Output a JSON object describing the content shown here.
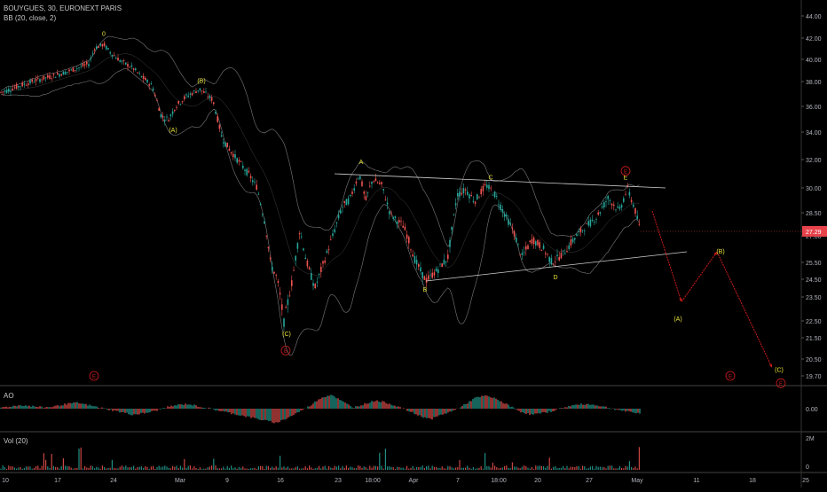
{
  "header": {
    "symbol_line": "BOUYGUES, 30, EURONEXT PARIS",
    "indicator_line": "BB (20, close, 2)"
  },
  "panes": {
    "ao_label": "AO",
    "vol_label": "Vol (20)"
  },
  "colors": {
    "background": "#000000",
    "candle_up": "#26a69a",
    "candle_down": "#ef5350",
    "bollinger": "#9a9a9a",
    "wave_label": "#e8e33a",
    "projection": "#d01c1c",
    "price_badge": "#e8424a",
    "trendline": "#cfcfcf"
  },
  "chart_data": [
    {
      "type": "line",
      "subtype": "candlestick",
      "title": "BOUYGUES, 30, EURONEXT PARIS",
      "indicator": "BB (20, close, 2)",
      "last_price": 27.29,
      "price_badge_label": "27.29",
      "ylim": [
        19.2,
        45.0
      ],
      "y_ticks": [
        44.0,
        42.0,
        40.0,
        38.0,
        36.0,
        34.0,
        32.0,
        30.0,
        28.5,
        27.0,
        25.5,
        24.5,
        23.5,
        22.5,
        21.5,
        20.5,
        19.7
      ],
      "x_ticks": [
        "10",
        "17",
        "24",
        "Mar",
        "9",
        "16",
        "23",
        "18:00",
        "Apr",
        "7",
        "18:00",
        "20",
        "27",
        "May",
        "11",
        "18",
        "25"
      ],
      "price_path": [
        [
          0,
          37.1
        ],
        [
          20,
          37.6
        ],
        [
          40,
          38.1
        ],
        [
          60,
          38.5
        ],
        [
          80,
          39.0
        ],
        [
          100,
          39.6
        ],
        [
          107,
          41.1
        ],
        [
          117,
          41.4
        ],
        [
          125,
          40.6
        ],
        [
          135,
          39.9
        ],
        [
          150,
          39.2
        ],
        [
          160,
          38.4
        ],
        [
          172,
          37.6
        ],
        [
          182,
          35.2
        ],
        [
          190,
          35.0
        ],
        [
          198,
          36.0
        ],
        [
          210,
          36.8
        ],
        [
          225,
          37.4
        ],
        [
          240,
          36.5
        ],
        [
          250,
          33.6
        ],
        [
          260,
          32.6
        ],
        [
          270,
          31.8
        ],
        [
          280,
          31.0
        ],
        [
          290,
          30.0
        ],
        [
          298,
          28.0
        ],
        [
          305,
          25.4
        ],
        [
          312,
          24.6
        ],
        [
          320,
          22.4
        ],
        [
          328,
          24.0
        ],
        [
          338,
          27.4
        ],
        [
          345,
          25.6
        ],
        [
          355,
          24.0
        ],
        [
          365,
          25.5
        ],
        [
          375,
          27.0
        ],
        [
          385,
          28.8
        ],
        [
          395,
          29.4
        ],
        [
          405,
          31.0
        ],
        [
          412,
          29.2
        ],
        [
          420,
          30.6
        ],
        [
          430,
          30.2
        ],
        [
          440,
          28.4
        ],
        [
          455,
          27.6
        ],
        [
          468,
          25.6
        ],
        [
          480,
          24.4
        ],
        [
          492,
          25.0
        ],
        [
          505,
          25.8
        ],
        [
          515,
          29.6
        ],
        [
          525,
          29.9
        ],
        [
          535,
          29.2
        ],
        [
          548,
          30.2
        ],
        [
          558,
          29.6
        ],
        [
          568,
          28.5
        ],
        [
          578,
          27.4
        ],
        [
          588,
          25.8
        ],
        [
          600,
          26.8
        ],
        [
          612,
          26.3
        ],
        [
          622,
          25.5
        ],
        [
          635,
          26.0
        ],
        [
          648,
          26.9
        ],
        [
          660,
          27.6
        ],
        [
          672,
          28.2
        ],
        [
          685,
          29.4
        ],
        [
          698,
          28.6
        ],
        [
          707,
          30.0
        ],
        [
          715,
          28.8
        ],
        [
          722,
          27.29
        ]
      ],
      "volume_scale_label": "2M"
    },
    {
      "type": "bar",
      "name": "AO",
      "zero_label": "0.00",
      "ylim": [
        -1.5,
        1.5
      ],
      "values": [
        0.1,
        0.2,
        0.3,
        0.2,
        0.1,
        0.2,
        0.4,
        0.5,
        0.3,
        0.1,
        -0.1,
        -0.3,
        -0.5,
        -0.4,
        -0.2,
        0.1,
        0.3,
        0.4,
        0.2,
        0.0,
        -0.2,
        -0.4,
        -0.6,
        -0.8,
        -1.0,
        -1.2,
        -0.8,
        -0.3,
        0.2,
        0.9,
        1.2,
        0.6,
        0.1,
        0.4,
        0.7,
        0.5,
        0.2,
        -0.2,
        -0.6,
        -0.9,
        -0.5,
        -0.2,
        0.3,
        0.9,
        1.1,
        0.8,
        0.3,
        -0.2,
        -0.5,
        -0.4,
        -0.2,
        0.1,
        0.3,
        0.4,
        0.3,
        0.1,
        -0.1,
        -0.3,
        -0.4
      ]
    },
    {
      "type": "bar",
      "name": "Vol (20)",
      "y_ticks": [
        "2M",
        "0"
      ]
    }
  ],
  "annotations": {
    "wave_labels": [
      {
        "text": "0",
        "at": [
          117,
          42.2
        ]
      },
      {
        "text": "(B)",
        "at": [
          227,
          37.9
        ]
      },
      {
        "text": "(A)",
        "at": [
          195,
          34.0
        ]
      },
      {
        "text": "A",
        "at": [
          407,
          31.7
        ]
      },
      {
        "text": "C",
        "at": [
          553,
          30.6
        ]
      },
      {
        "text": "E",
        "at": [
          705,
          30.6
        ]
      },
      {
        "text": "B",
        "at": [
          479,
          23.8
        ]
      },
      {
        "text": "D",
        "at": [
          626,
          24.5
        ]
      },
      {
        "text": "(C)",
        "at": [
          323,
          21.6
        ]
      },
      {
        "text": "(A)",
        "at": [
          764,
          22.5
        ]
      },
      {
        "text": "(B)",
        "at": [
          812,
          26.0
        ]
      },
      {
        "text": "(C)",
        "at": [
          878,
          19.9
        ]
      }
    ],
    "circled_labels": [
      {
        "text": "B",
        "at": [
          322,
          20.9
        ]
      },
      {
        "text": "E",
        "at": [
          705,
          31.2
        ]
      },
      {
        "text": "E",
        "at": [
          106,
          19.7
        ]
      },
      {
        "text": "E",
        "at": [
          823,
          19.7
        ]
      },
      {
        "text": "E",
        "at": [
          880,
          19.35
        ]
      }
    ],
    "triangle_upper": [
      [
        377,
        31.0
      ],
      [
        750,
        30.0
      ]
    ],
    "triangle_lower": [
      [
        480,
        24.4
      ],
      [
        774,
        26.1
      ]
    ],
    "projection_path": [
      [
        735,
        28.6
      ],
      [
        768,
        23.3
      ],
      [
        808,
        26.1
      ],
      [
        870,
        20.1
      ]
    ]
  }
}
